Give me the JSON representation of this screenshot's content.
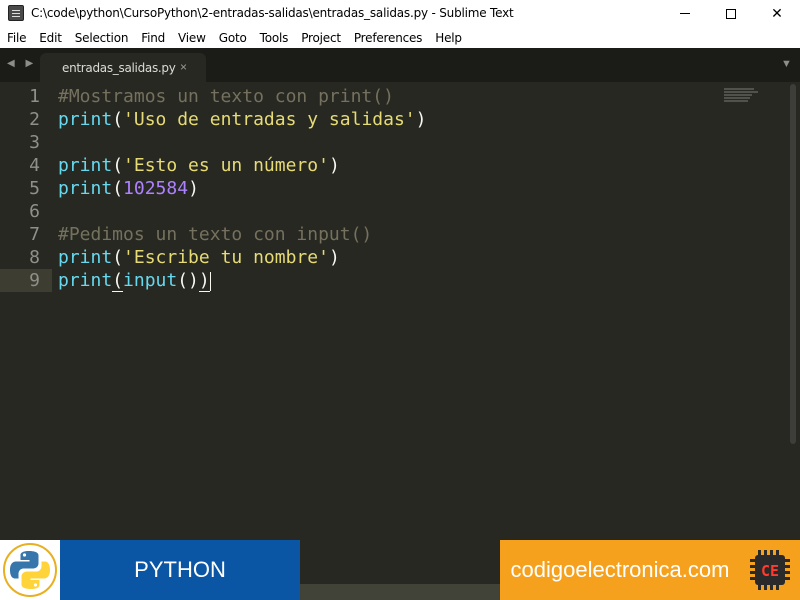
{
  "window": {
    "title": "C:\\code\\python\\CursoPython\\2-entradas-salidas\\entradas_salidas.py - Sublime Text",
    "minimize_glyph": "minimize-icon",
    "maximize_glyph": "maximize-icon",
    "close_glyph": "✕"
  },
  "menu": [
    "File",
    "Edit",
    "Selection",
    "Find",
    "View",
    "Goto",
    "Tools",
    "Project",
    "Preferences",
    "Help"
  ],
  "tabs": {
    "nav_arrows": "◀ ▶",
    "active_tab": "entradas_salidas.py",
    "close_glyph": "×",
    "dropdown_glyph": "▼"
  },
  "editor": {
    "line_numbers": [
      "1",
      "2",
      "3",
      "4",
      "5",
      "6",
      "7",
      "8",
      "9"
    ],
    "current_line": 9,
    "lines": [
      [
        {
          "t": "#Mostramos un texto con print()",
          "c": "comment"
        }
      ],
      [
        {
          "t": "print",
          "c": "func"
        },
        {
          "t": "(",
          "c": "paren"
        },
        {
          "t": "'Uso de entradas y salidas'",
          "c": "string"
        },
        {
          "t": ")",
          "c": "paren"
        }
      ],
      [],
      [
        {
          "t": "print",
          "c": "func"
        },
        {
          "t": "(",
          "c": "paren"
        },
        {
          "t": "'Esto es un número'",
          "c": "string"
        },
        {
          "t": ")",
          "c": "paren"
        }
      ],
      [
        {
          "t": "print",
          "c": "func"
        },
        {
          "t": "(",
          "c": "paren"
        },
        {
          "t": "102584",
          "c": "number"
        },
        {
          "t": ")",
          "c": "paren"
        }
      ],
      [],
      [
        {
          "t": "#Pedimos un texto con input()",
          "c": "comment"
        }
      ],
      [
        {
          "t": "print",
          "c": "func"
        },
        {
          "t": "(",
          "c": "paren"
        },
        {
          "t": "'Escribe tu nombre'",
          "c": "string"
        },
        {
          "t": ")",
          "c": "paren"
        }
      ],
      [
        {
          "t": "print",
          "c": "func"
        },
        {
          "t": "(",
          "c": "paren",
          "m": true
        },
        {
          "t": "input",
          "c": "func"
        },
        {
          "t": "()",
          "c": "paren"
        },
        {
          "t": ")",
          "c": "paren",
          "m": true
        },
        {
          "cursor": true
        }
      ]
    ]
  },
  "banner": {
    "python_label": "PYTHON",
    "site_label": "codigoelectronica.com",
    "python_logo": "python-logo",
    "site_logo": "CE"
  },
  "colors": {
    "editor_bg": "#272822",
    "comment": "#75715e",
    "function": "#66d9ef",
    "string": "#e6db74",
    "number": "#ae81ff",
    "python_panel": "#0b56a4",
    "site_panel": "#f6a11d"
  }
}
